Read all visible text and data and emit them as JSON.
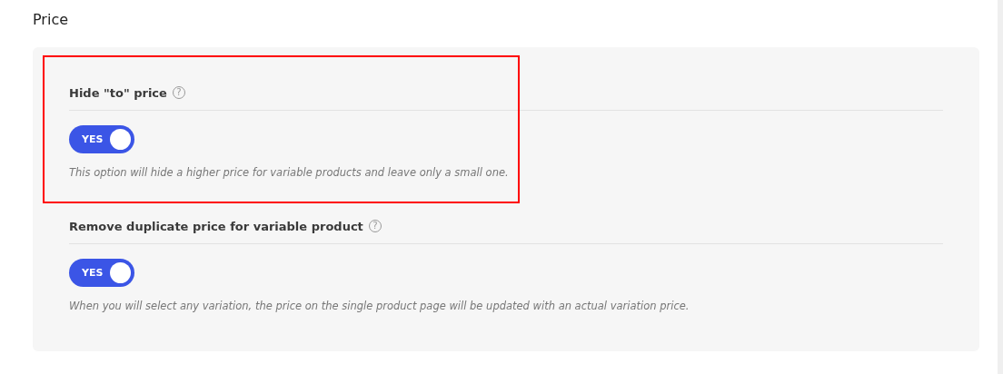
{
  "section": {
    "title": "Price"
  },
  "settings": [
    {
      "label": "Hide \"to\" price",
      "help_icon": "?",
      "toggle": {
        "on": true,
        "text": "YES"
      },
      "description": "This option will hide a higher price for variable products and leave only a small one.",
      "highlighted": true
    },
    {
      "label": "Remove duplicate price for variable product",
      "help_icon": "?",
      "toggle": {
        "on": true,
        "text": "YES"
      },
      "description": "When you will select any variation, the price on the single product page will be updated with an actual variation price.",
      "highlighted": false
    }
  ]
}
